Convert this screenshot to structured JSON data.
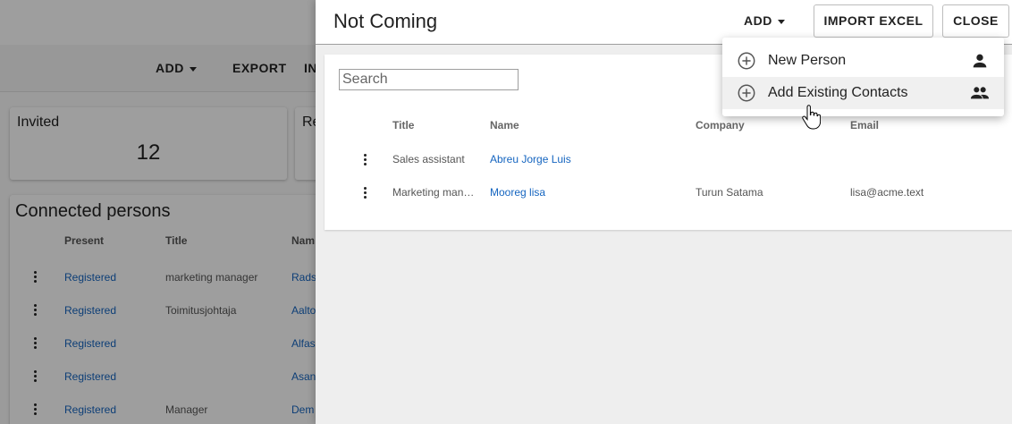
{
  "background": {
    "toolbar": {
      "add_label": "ADD",
      "export_label": "EXPORT",
      "partial_label": "IN"
    },
    "invited_card": {
      "label": "Invited",
      "count": "12"
    },
    "second_card": {
      "label": "Re"
    },
    "persons": {
      "title": "Connected persons",
      "columns": [
        "Present",
        "Title",
        "Nam"
      ],
      "rows": [
        {
          "present": "Registered",
          "title": "marketing manager",
          "name": "Rads"
        },
        {
          "present": "Registered",
          "title": "Toimitusjohtaja",
          "name": "Aalto"
        },
        {
          "present": "Registered",
          "title": "",
          "name": "Alfas"
        },
        {
          "present": "Registered",
          "title": "",
          "name": "Asan"
        },
        {
          "present": "Registered",
          "title": "Manager",
          "name": "Dem"
        }
      ]
    }
  },
  "drawer": {
    "title": "Not Coming",
    "add_label": "ADD",
    "import_label": "IMPORT EXCEL",
    "close_label": "CLOSE",
    "search": {
      "placeholder": "Search",
      "value": ""
    },
    "columns": {
      "title": "Title",
      "name": "Name",
      "company": "Company",
      "email": "Email"
    },
    "rows": [
      {
        "title": "Sales assistant",
        "name": "Abreu Jorge Luis",
        "company": "",
        "email": ""
      },
      {
        "title": "Marketing manager",
        "name": "Mooreg lisa",
        "company": "Turun Satama",
        "email": "lisa@acme.text"
      }
    ]
  },
  "menu": {
    "items": [
      {
        "label": "New Person",
        "icon": "person-icon"
      },
      {
        "label": "Add Existing Contacts",
        "icon": "people-icon"
      }
    ]
  }
}
